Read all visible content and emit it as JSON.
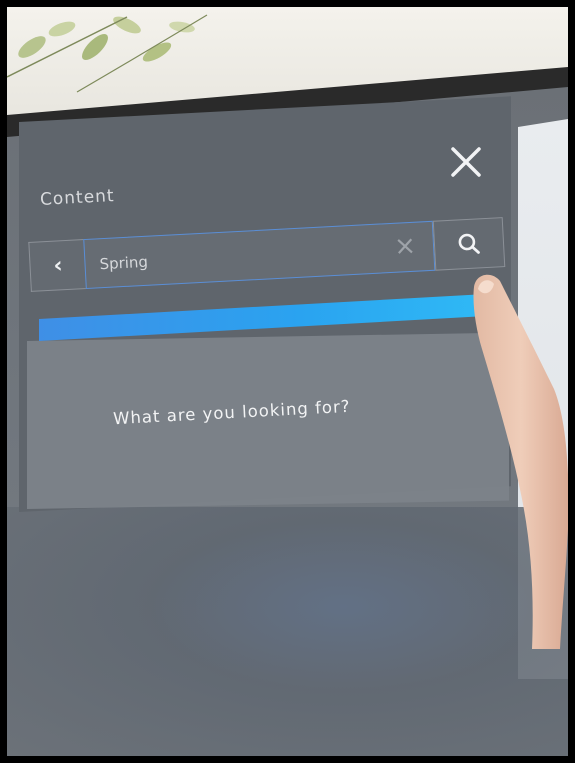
{
  "panel": {
    "title": "Content",
    "close_icon": "close-icon"
  },
  "search": {
    "back_icon": "chevron-left-icon",
    "value": "Spring",
    "clear_icon": "clear-x-icon",
    "search_icon": "search-icon"
  },
  "results": {
    "prompt": "What are you looking for?"
  },
  "colors": {
    "accent_blue": "#2aa3f0",
    "input_border": "#5a8ed6",
    "panel_bg": "#5f656c"
  }
}
